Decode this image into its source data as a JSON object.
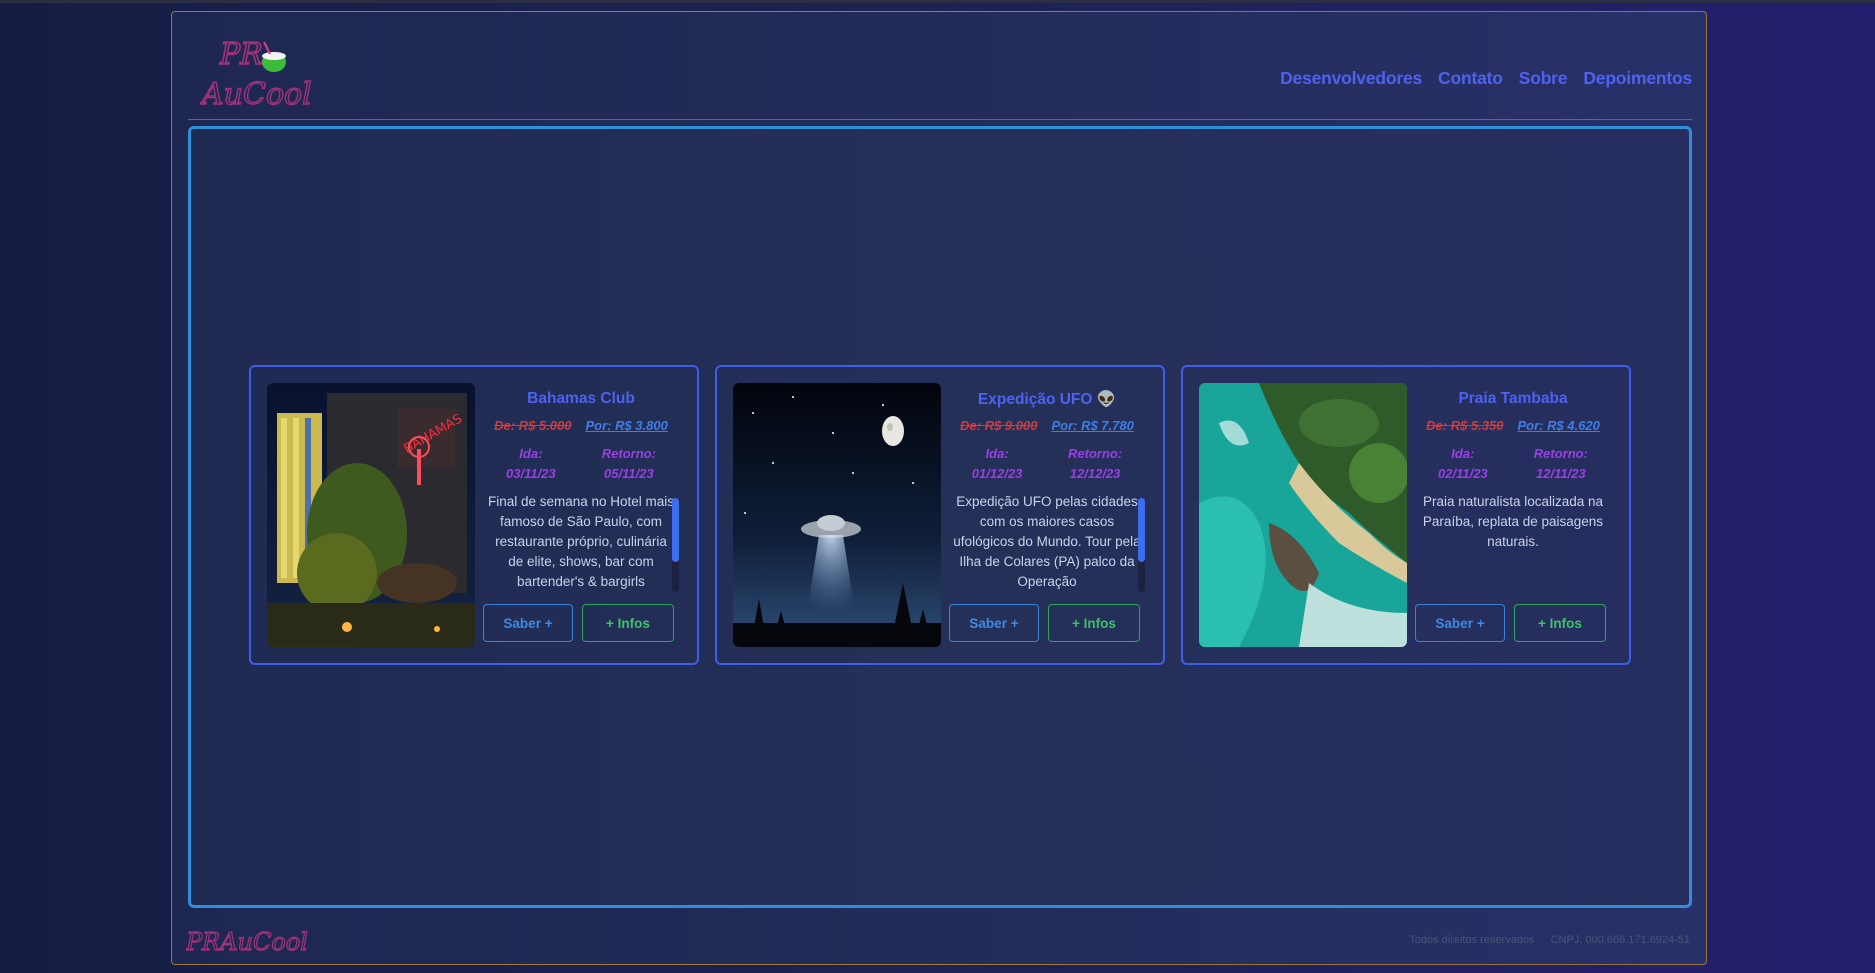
{
  "brand": {
    "logo_top": "PR",
    "logo_bottom": "AuCool",
    "footer_logo": "PRAuCool"
  },
  "nav": [
    {
      "label": "Desenvolvedores"
    },
    {
      "label": "Contato"
    },
    {
      "label": "Sobre"
    },
    {
      "label": "Depoimentos"
    }
  ],
  "cards": [
    {
      "title": "Bahamas Club",
      "old_price": "De: R$ 5.000",
      "new_price": "Por: R$ 3.800",
      "depart_label": "Ida:",
      "depart_date": "03/11/23",
      "return_label": "Retorno:",
      "return_date": "05/11/23",
      "description": "Final de semana no Hotel mais famoso de São Paulo, com restaurante próprio, culinária de elite, shows, bar com bartender's & bargirls",
      "saber_label": "Saber +",
      "infos_label": "+ Infos",
      "image": "hotel-night"
    },
    {
      "title": "Expedição UFO 👽",
      "old_price": "De: R$ 9.000",
      "new_price": "Por: R$ 7.780",
      "depart_label": "Ida:",
      "depart_date": "01/12/23",
      "return_label": "Retorno:",
      "return_date": "12/12/23",
      "description": "Expedição UFO pelas cidades com os maiores casos ufológicos do Mundo. Tour pela Ilha de Colares (PA) palco da Operação",
      "saber_label": "Saber +",
      "infos_label": "+ Infos",
      "image": "ufo-night-sky"
    },
    {
      "title": "Praia Tambaba",
      "old_price": "De: R$ 5.350",
      "new_price": "Por: R$ 4.620",
      "depart_label": "Ida:",
      "depart_date": "02/11/23",
      "return_label": "Retorno:",
      "return_date": "12/11/23",
      "description": "Praia naturalista localizada na Paraíba, replata de paisagens naturais.",
      "saber_label": "Saber +",
      "infos_label": "+ Infos",
      "image": "beach-aerial"
    }
  ],
  "footer": {
    "rights": "Todos direitos reservados",
    "cnpj": "CNPJ: 000.666.171.6924-51"
  },
  "colors": {
    "accent": "#4d63f0",
    "frame_border": "#9a7a3c",
    "stage_border": "#2f8fd6",
    "old_price": "#d03b3b",
    "date": "#9a3fe6",
    "infos_green": "#3cc267"
  }
}
